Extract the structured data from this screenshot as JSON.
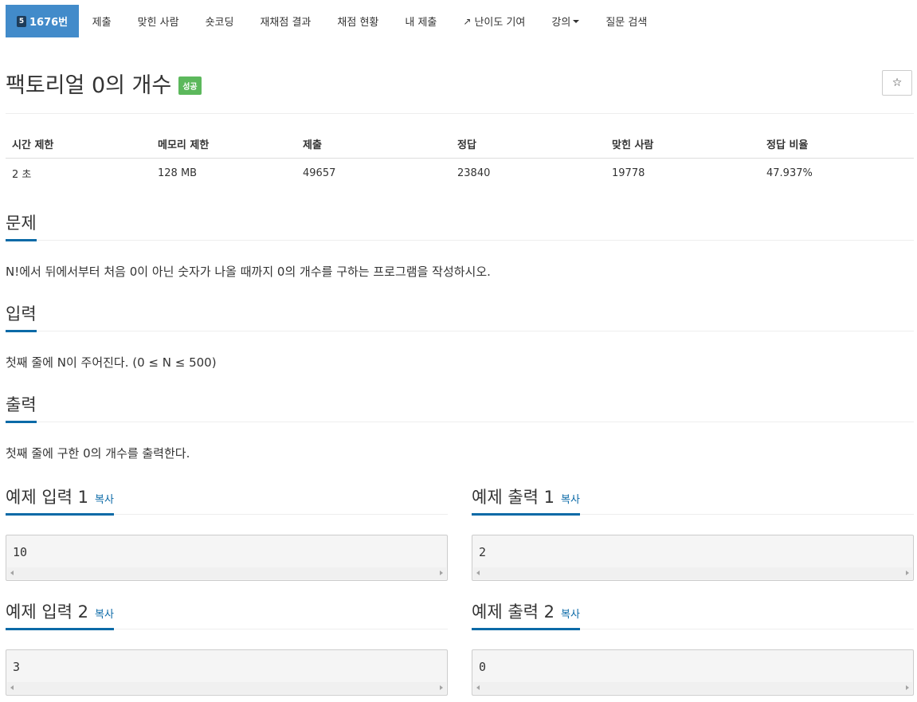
{
  "nav": {
    "problem_badge": "5",
    "problem_label": "1676번",
    "items": [
      "제출",
      "맞힌 사람",
      "숏코딩",
      "재채점 결과",
      "채점 현황",
      "내 제출",
      "난이도 기여",
      "강의",
      "질문 검색"
    ]
  },
  "problem": {
    "title": "팩토리얼 0의 개수",
    "status": "성공",
    "star": "☆"
  },
  "stats": {
    "headers": [
      "시간 제한",
      "메모리 제한",
      "제출",
      "정답",
      "맞힌 사람",
      "정답 비율"
    ],
    "values": [
      "2 초",
      "128 MB",
      "49657",
      "23840",
      "19778",
      "47.937%"
    ]
  },
  "sections": {
    "problem": {
      "title": "문제",
      "text": "N!에서 뒤에서부터 처음 0이 아닌 숫자가 나올 때까지 0의 개수를 구하는 프로그램을 작성하시오."
    },
    "input": {
      "title": "입력",
      "text": "첫째 줄에 N이 주어진다. (0 ≤ N ≤ 500)"
    },
    "output": {
      "title": "출력",
      "text": "첫째 줄에 구한 0의 개수를 출력한다."
    }
  },
  "samples": {
    "copy_label": "복사",
    "in1": {
      "title": "예제 입력 1",
      "value": "10"
    },
    "out1": {
      "title": "예제 출력 1",
      "value": "2"
    },
    "in2": {
      "title": "예제 입력 2",
      "value": "3"
    },
    "out2": {
      "title": "예제 출력 2",
      "value": "0"
    }
  },
  "colors": {
    "accent": "#428bca",
    "success": "#5cb85c",
    "underline": "#0b6aa7"
  }
}
